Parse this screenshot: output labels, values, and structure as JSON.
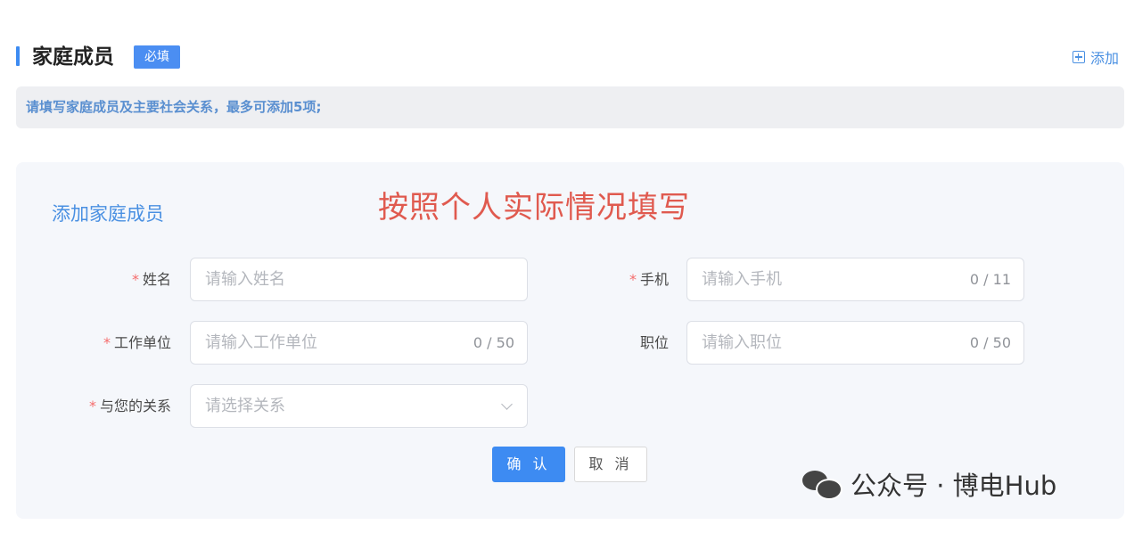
{
  "section": {
    "title": "家庭成员",
    "required_badge": "必填",
    "add_label": "添加"
  },
  "tip": "请填写家庭成员及主要社会关系，最多可添加5项;",
  "card": {
    "title": "添加家庭成员",
    "note": "按照个人实际情况填写",
    "fields": {
      "name": {
        "label": "姓名",
        "placeholder": "请输入姓名",
        "value": ""
      },
      "phone": {
        "label": "手机",
        "placeholder": "请输入手机",
        "value": "",
        "counter": "0 / 11"
      },
      "work_unit": {
        "label": "工作单位",
        "placeholder": "请输入工作单位",
        "value": "",
        "counter": "0 / 50"
      },
      "position": {
        "label": "职位",
        "placeholder": "请输入职位",
        "value": "",
        "counter": "0 / 50"
      },
      "relation": {
        "label": "与您的关系",
        "placeholder": "请选择关系"
      }
    },
    "buttons": {
      "confirm": "确 认",
      "cancel": "取 消"
    }
  },
  "watermark": "公众号 · 博电Hub",
  "colors": {
    "accent": "#3d8bf2",
    "required_star": "#f56c6c",
    "note_red": "#e05a4f"
  }
}
